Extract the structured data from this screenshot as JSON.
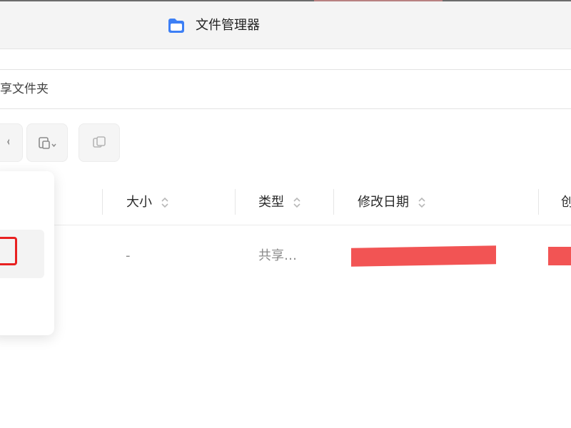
{
  "window": {
    "title": "文件管理器",
    "app_icon": "folder-icon",
    "accent_color": "#3d7ff5"
  },
  "address_bar": {
    "path_text": "享文件夹"
  },
  "toolbar": {
    "buttons": [
      {
        "icon": "partial-icon"
      },
      {
        "icon": "paste-dropdown-icon"
      },
      {
        "icon": "copy-icon"
      }
    ]
  },
  "file_table": {
    "columns": [
      {
        "label": "大小"
      },
      {
        "label": "类型"
      },
      {
        "label": "修改日期"
      },
      {
        "label": "创"
      }
    ],
    "rows": [
      {
        "size": "-",
        "type": "共享…",
        "redaction_color": "#f25454"
      }
    ]
  },
  "context_popup": {
    "highlight_color": "#e82020"
  }
}
